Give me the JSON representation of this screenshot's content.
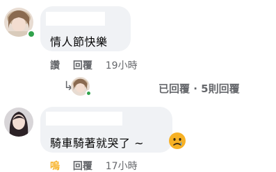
{
  "comments": [
    {
      "text": "情人節快樂",
      "actions": {
        "reaction": "讚",
        "reply": "回覆",
        "time": "19小時"
      },
      "avatar_online": true,
      "replies_summary": "已回覆 · 5則回覆"
    },
    {
      "text": "騎車騎著就哭了 ~",
      "emoji": "sad-face",
      "actions": {
        "reaction": "嗚",
        "reply": "回覆",
        "time": "17小時"
      }
    }
  ],
  "colors": {
    "bubble": "#f0f2f5",
    "meta_text": "#65676b",
    "online": "#31a24c",
    "reaction_active": "#f7b125"
  }
}
